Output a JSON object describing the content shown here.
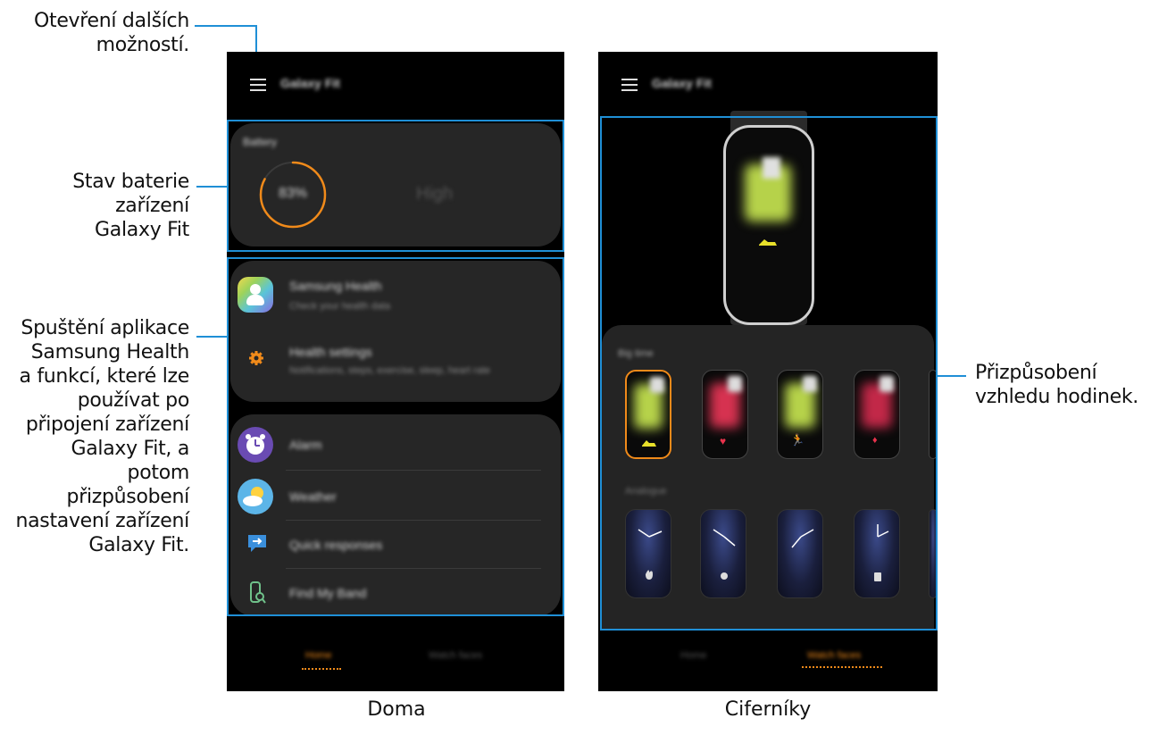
{
  "callouts": {
    "more_options": "Otevření dalších\nmožností.",
    "battery": "Stav baterie\nzařízení\nGalaxy Fit",
    "launch": "Spuštění aplikace\nSamsung Health\na funkcí, které lze\npoužívat po\npřipojení zařízení\nGalaxy Fit, a\npotom\npřizpůsobení\nnastavení zařízení\nGalaxy Fit.",
    "customize": "Přizpůsobení\nvzhledu hodinek."
  },
  "captions": {
    "home": "Doma",
    "watchfaces": "Ciferníky"
  },
  "left_screen": {
    "title": "Galaxy Fit",
    "battery": {
      "label": "Battery",
      "percent": "83%",
      "status": "High",
      "level": 0.83
    },
    "health_card": [
      {
        "title": "Samsung Health",
        "subtitle": "Check your health data",
        "icon": "samsung-health-icon"
      },
      {
        "title": "Health settings",
        "subtitle": "Notifications, steps, exercise, sleep, heart rate",
        "icon": "gear-icon"
      }
    ],
    "apps_card": [
      {
        "title": "Alarm",
        "icon": "alarm-clock-icon"
      },
      {
        "title": "Weather",
        "icon": "weather-icon"
      },
      {
        "title": "Quick responses",
        "icon": "quick-response-icon"
      },
      {
        "title": "Find My Band",
        "icon": "find-band-icon"
      }
    ],
    "nav": {
      "home": "Home",
      "watchfaces": "Watch faces"
    }
  },
  "right_screen": {
    "title": "Galaxy Fit",
    "section_big_time": "Big time",
    "section_analogue": "Analogue",
    "nav": {
      "home": "Home",
      "watchfaces": "Watch faces"
    }
  },
  "colors": {
    "accent": "#f08a1a",
    "highlight": "#1f8fd6"
  }
}
